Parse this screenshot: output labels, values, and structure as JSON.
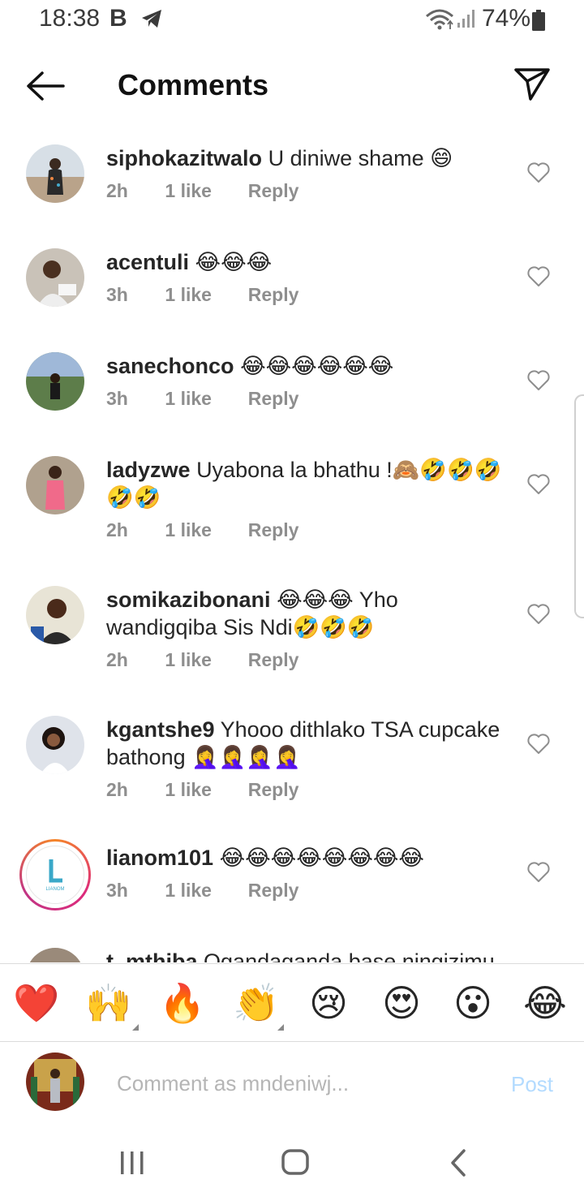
{
  "status_bar": {
    "time": "18:38",
    "notification_letter": "B",
    "battery_percent": "74%"
  },
  "header": {
    "title": "Comments"
  },
  "comments": [
    {
      "username": "siphokazitwalo",
      "text": "U diniwe shame 😄",
      "time": "2h",
      "likes": "1 like",
      "reply": "Reply"
    },
    {
      "username": "acentuli",
      "text": "😂😂😂",
      "time": "3h",
      "likes": "1 like",
      "reply": "Reply"
    },
    {
      "username": "sanechonco",
      "text": "😂😂😂😂😂😂",
      "time": "3h",
      "likes": "1 like",
      "reply": "Reply"
    },
    {
      "username": "ladyzwe",
      "text": "Uyabona la bhathu !🙈🤣🤣🤣🤣🤣",
      "time": "2h",
      "likes": "1 like",
      "reply": "Reply"
    },
    {
      "username": "somikazibonani",
      "text": "😂😂😂 Yho wandigqiba Sis Ndi🤣🤣🤣",
      "time": "2h",
      "likes": "1 like",
      "reply": "Reply"
    },
    {
      "username": "kgantshe9",
      "text": "Yhooo dithlako TSA cupcake bathong 🤦‍♀️🤦‍♀️🤦‍♀️🤦‍♀️",
      "time": "2h",
      "likes": "1 like",
      "reply": "Reply"
    },
    {
      "username": "lianom101",
      "text": "😂😂😂😂😂😂😂😂",
      "time": "3h",
      "likes": "1 like",
      "reply": "Reply"
    },
    {
      "username": "t_mthiba",
      "text": "Ogandaganda base ningizimu",
      "time": "",
      "likes": "",
      "reply": ""
    }
  ],
  "lianom_logo_text": "LIANOM",
  "emoji_bar": [
    "❤️",
    "🙌",
    "🔥",
    "👏",
    "😢",
    "😍",
    "😮",
    "😂"
  ],
  "composer": {
    "placeholder": "Comment as mndeniwj...",
    "post_label": "Post"
  },
  "colors": {
    "meta_gray": "#8e8e8e",
    "post_disabled": "#b3dbff",
    "heart_outline": "#8e8e8e",
    "story_ring": "#dd2a7b"
  }
}
